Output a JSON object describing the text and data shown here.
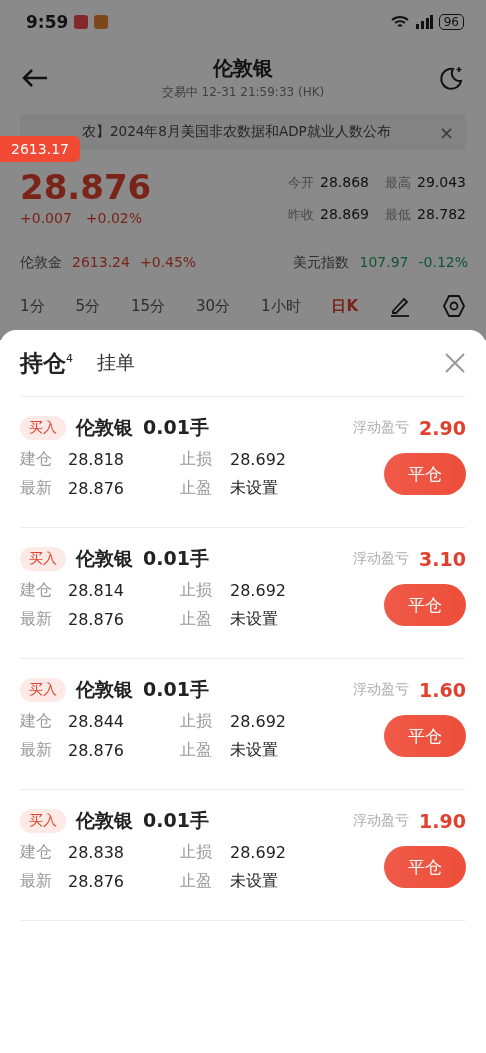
{
  "status_bar": {
    "time": "9:59",
    "battery": "96"
  },
  "header": {
    "title": "伦敦银",
    "subtitle": "交易中  12-31 21:59:33 (HK)"
  },
  "news": {
    "text": "农】2024年8月美国非农数据和ADP就业人数公布",
    "close": "×"
  },
  "floating_badge": {
    "value": "2613.17"
  },
  "quote": {
    "price": "28.876",
    "change": "+0.007",
    "change_pct": "+0.02%",
    "color": "#792319",
    "stats": [
      {
        "label": "今开",
        "value": "28.868"
      },
      {
        "label": "最高",
        "value": "29.043"
      },
      {
        "label": "昨收",
        "value": "28.869"
      },
      {
        "label": "最低",
        "value": "28.782"
      }
    ]
  },
  "related": [
    {
      "name": "伦敦金",
      "value": "2613.24",
      "change": "+0.45%",
      "color": "#792319"
    },
    {
      "name": "美元指数",
      "value": "107.97",
      "change": "-0.12%",
      "color": "#105534"
    }
  ],
  "timeframes": [
    {
      "label": "1分",
      "selected": false
    },
    {
      "label": "5分",
      "selected": false
    },
    {
      "label": "15分",
      "selected": false
    },
    {
      "label": "30分",
      "selected": false
    },
    {
      "label": "1小时",
      "selected": false
    },
    {
      "label": "日K",
      "selected": true
    }
  ],
  "sheet": {
    "tabs": [
      {
        "label": "持仓",
        "count": "4",
        "selected": true
      },
      {
        "label": "挂单",
        "selected": false
      }
    ],
    "positions": [
      {
        "side": "买入",
        "name": "伦敦银",
        "qty": "0.01手",
        "pnl_label": "浮动盈亏",
        "pnl": "2.90",
        "open_label": "建仓",
        "open": "28.818",
        "sl_label": "止损",
        "sl": "28.692",
        "last_label": "最新",
        "last": "28.876",
        "tp_label": "止盈",
        "tp": "未设置",
        "button": "平仓"
      },
      {
        "side": "买入",
        "name": "伦敦银",
        "qty": "0.01手",
        "pnl_label": "浮动盈亏",
        "pnl": "3.10",
        "open_label": "建仓",
        "open": "28.814",
        "sl_label": "止损",
        "sl": "28.692",
        "last_label": "最新",
        "last": "28.876",
        "tp_label": "止盈",
        "tp": "未设置",
        "button": "平仓"
      },
      {
        "side": "买入",
        "name": "伦敦银",
        "qty": "0.01手",
        "pnl_label": "浮动盈亏",
        "pnl": "1.60",
        "open_label": "建仓",
        "open": "28.844",
        "sl_label": "止损",
        "sl": "28.692",
        "last_label": "最新",
        "last": "28.876",
        "tp_label": "止盈",
        "tp": "未设置",
        "button": "平仓"
      },
      {
        "side": "买入",
        "name": "伦敦银",
        "qty": "0.01手",
        "pnl_label": "浮动盈亏",
        "pnl": "1.90",
        "open_label": "建仓",
        "open": "28.838",
        "sl_label": "止损",
        "sl": "28.692",
        "last_label": "最新",
        "last": "28.876",
        "tp_label": "止盈",
        "tp": "未设置",
        "button": "平仓"
      }
    ]
  }
}
